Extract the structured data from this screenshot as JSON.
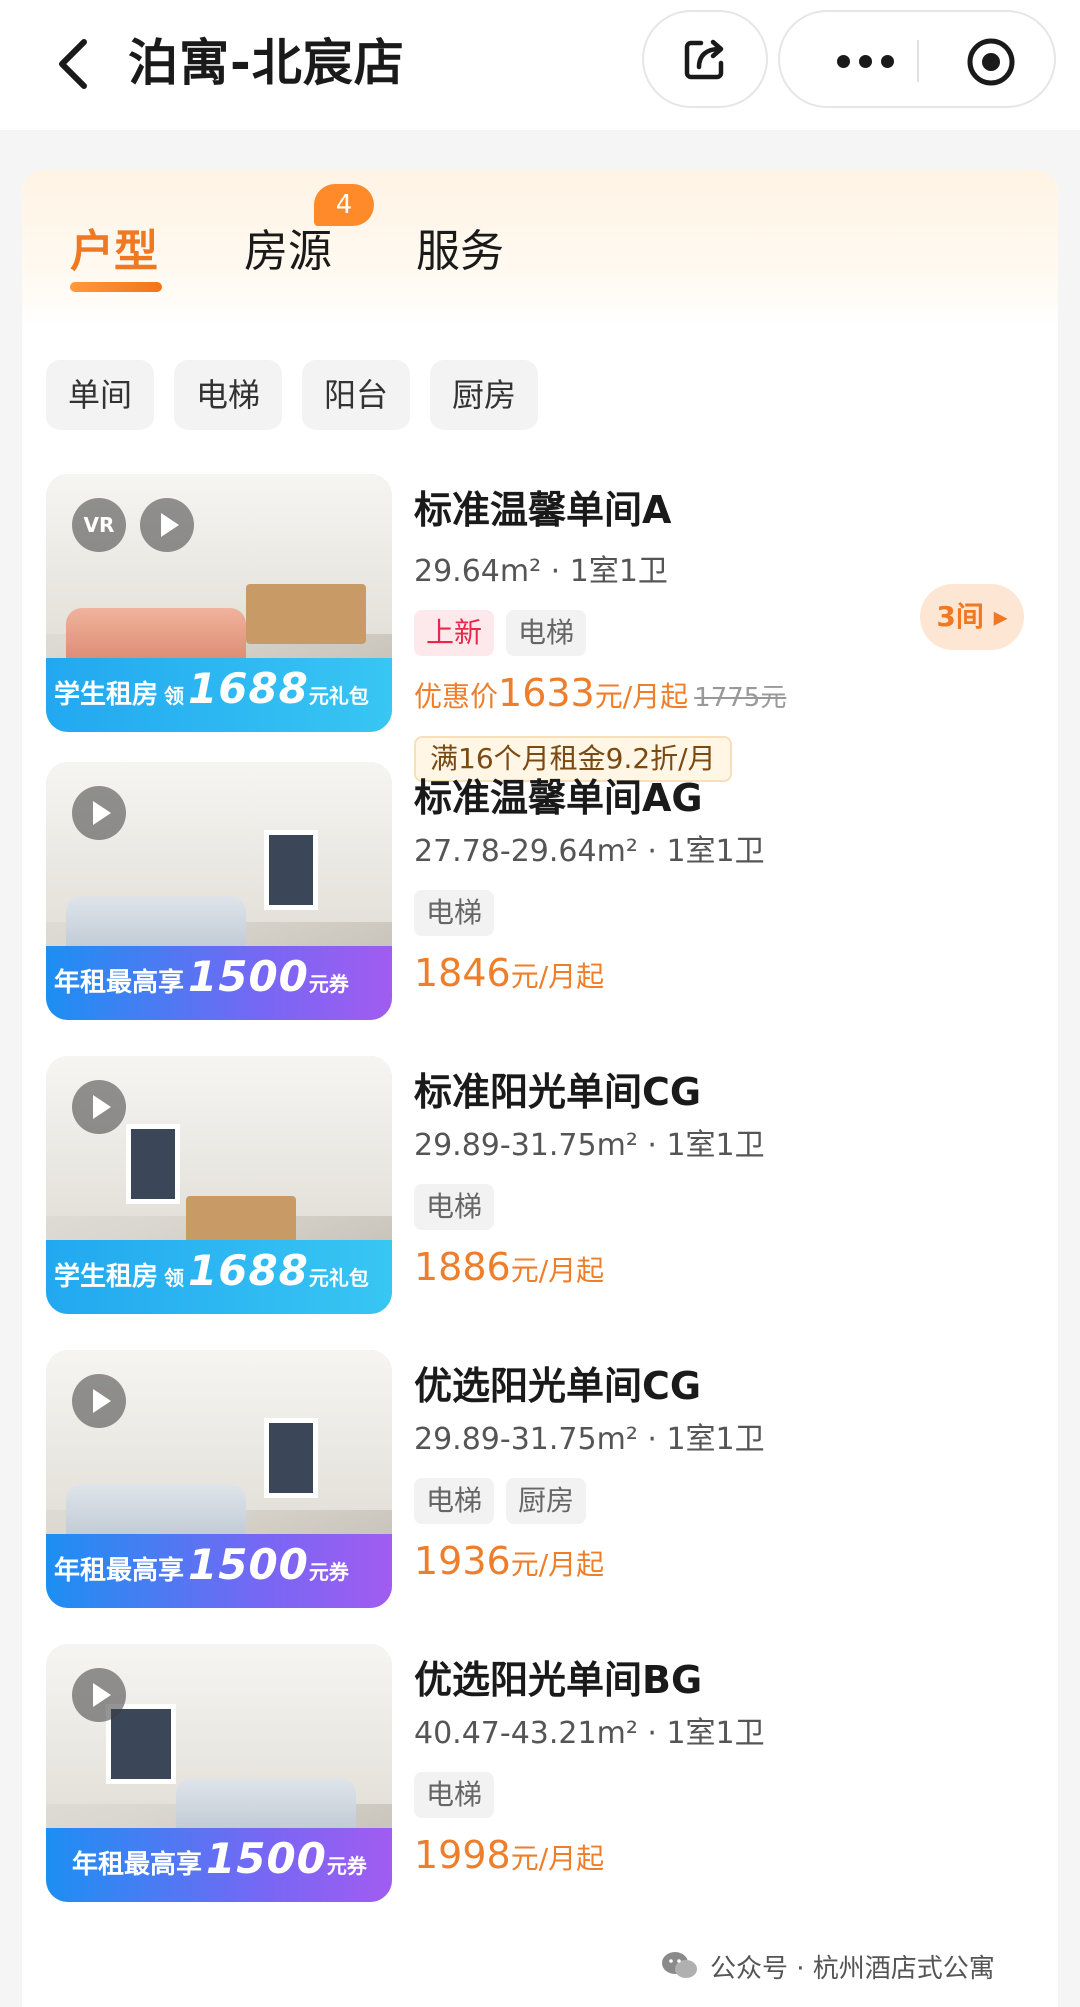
{
  "header": {
    "title": "泊寓-北宸店"
  },
  "tabs": [
    {
      "label": "户型",
      "active": true
    },
    {
      "label": "房源",
      "active": false,
      "badge": "4"
    },
    {
      "label": "服务",
      "active": false
    }
  ],
  "filters": [
    "单间",
    "电梯",
    "阳台",
    "厨房"
  ],
  "listings": [
    {
      "name": "标准温馨单间A",
      "spec": "29.64m² · 1室1卫",
      "tags": [
        "上新",
        "电梯"
      ],
      "price_label": "优惠价",
      "price": "1633",
      "price_unit": "元/月起",
      "original_price": "1775元",
      "promo": "满16个月租金9.2折/月",
      "rooms_available": "3间 ▸",
      "banner": {
        "main": "学生租房",
        "small": "领",
        "num": "1688",
        "unit": "元礼包"
      },
      "badges": [
        "VR"
      ]
    },
    {
      "name": "标准温馨单间AG",
      "spec": "27.78-29.64m² · 1室1卫",
      "tags": [
        "电梯"
      ],
      "price": "1846",
      "price_unit": "元/月起",
      "banner": {
        "main": "年租最高享",
        "num": "1500",
        "unit": "元券"
      }
    },
    {
      "name": "标准阳光单间CG",
      "spec": "29.89-31.75m² · 1室1卫",
      "tags": [
        "电梯"
      ],
      "price": "1886",
      "price_unit": "元/月起",
      "banner": {
        "main": "学生租房",
        "small": "领",
        "num": "1688",
        "unit": "元礼包"
      }
    },
    {
      "name": "优选阳光单间CG",
      "spec": "29.89-31.75m² · 1室1卫",
      "tags": [
        "电梯",
        "厨房"
      ],
      "price": "1936",
      "price_unit": "元/月起",
      "banner": {
        "main": "年租最高享",
        "num": "1500",
        "unit": "元券"
      }
    },
    {
      "name": "优选阳光单间BG",
      "spec": "40.47-43.21m² · 1室1卫",
      "tags": [
        "电梯"
      ],
      "price": "1998",
      "price_unit": "元/月起",
      "banner": {
        "main": "年租最高享",
        "num": "1500",
        "unit": "元券"
      }
    }
  ],
  "watermark": "公众号 · 杭州酒店式公寓",
  "colors": {
    "accent": "#f07820",
    "price": "#ee7e2a",
    "new_tag": "#e8284a"
  }
}
